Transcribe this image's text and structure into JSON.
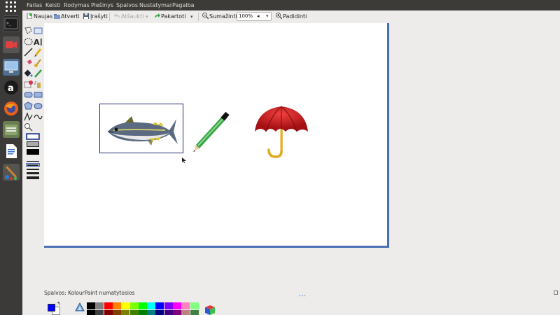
{
  "menubar": {
    "items": [
      "Failas",
      "Keisti",
      "Rodymas",
      "Piešinys",
      "Spalvos",
      "Nustatymai",
      "Pagalba"
    ]
  },
  "toolbar": {
    "new_label": "Naujas",
    "open_label": "Atverti",
    "save_label": "Įrašyti",
    "undo_label": "Atšaukti",
    "redo_label": "Pakartoti",
    "zoom_out_label": "Sumažinti",
    "zoom_value": "100%",
    "zoom_in_label": "Padidinti"
  },
  "palette": {
    "label": "Spalvos: KolourPaint numatytosios",
    "colors_row1": [
      "#000000",
      "#808080",
      "#ff0000",
      "#ff8000",
      "#ffff00",
      "#80ff00",
      "#00ff00",
      "#00ffff",
      "#0000ff",
      "#8000ff",
      "#ff00ff",
      "#ff80c0",
      "#80ff80"
    ],
    "colors_row2": [
      "#000000",
      "#404040",
      "#800000",
      "#804000",
      "#808000",
      "#408000",
      "#008000",
      "#008080",
      "#000080",
      "#400080",
      "#800080",
      "#c08080",
      "#408040"
    ],
    "foreground": "#0000ff",
    "background": "#ffffff"
  },
  "canvas": {
    "objects": [
      "fish-image",
      "pencil-image",
      "umbrella-image"
    ]
  },
  "launcher": {
    "icons": [
      "apps-grid-icon",
      "terminal-icon",
      "screen-recorder-icon",
      "remote-desktop-icon",
      "amazon-icon",
      "firefox-icon",
      "files-icon",
      "writer-icon",
      "kolourpaint-icon"
    ]
  }
}
